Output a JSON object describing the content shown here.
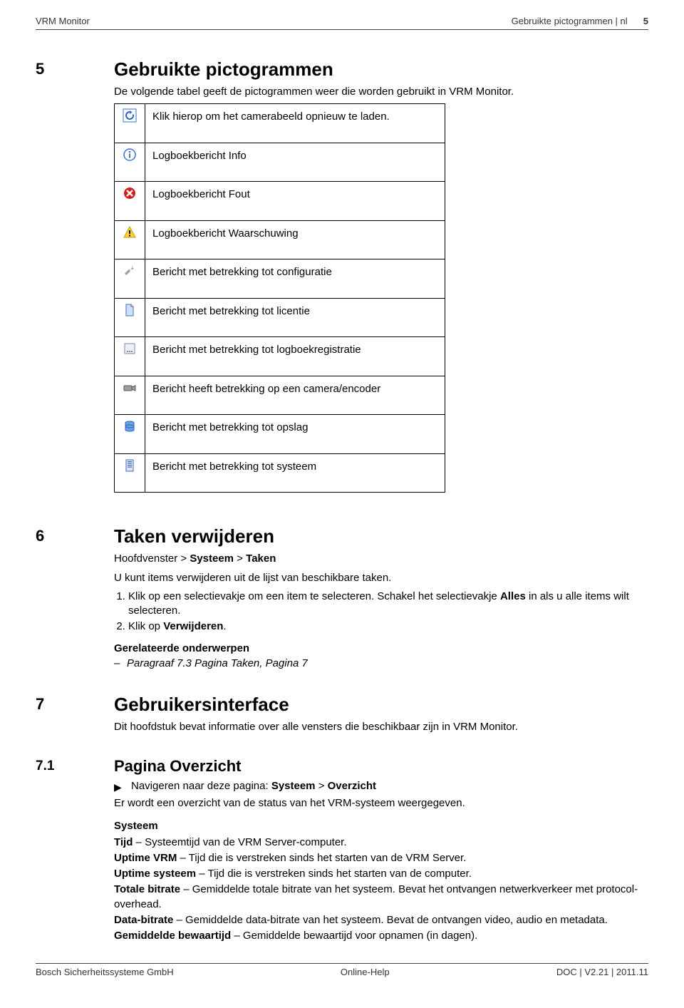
{
  "header": {
    "left": "VRM Monitor",
    "right_title": "Gebruikte pictogrammen | nl",
    "page_num": "5"
  },
  "sec5": {
    "num": "5",
    "title": "Gebruikte pictogrammen",
    "intro": "De volgende tabel geeft de pictogrammen weer die worden gebruikt in VRM Monitor.",
    "rows": [
      "Klik hierop om het camerabeeld opnieuw te laden.",
      "Logboekbericht Info",
      "Logboekbericht Fout",
      "Logboekbericht Waarschuwing",
      "Bericht met betrekking tot configuratie",
      "Bericht met betrekking tot licentie",
      "Bericht met betrekking tot logboekregistratie",
      "Bericht heeft betrekking op een camera/encoder",
      "Bericht met betrekking tot opslag",
      "Bericht met betrekking tot systeem"
    ]
  },
  "sec6": {
    "num": "6",
    "title": "Taken verwijderen",
    "breadcrumb_pre": "Hoofdvenster > ",
    "breadcrumb_b1": "Systeem",
    "breadcrumb_mid": " > ",
    "breadcrumb_b2": "Taken",
    "line1": "U kunt items verwijderen uit de lijst van beschikbare taken.",
    "step1_a": "Klik op een selectievakje om een item te selecteren. Schakel het selectievakje ",
    "step1_b": "Alles",
    "step1_c": " in als u alle items wilt selecteren.",
    "step2_a": "Klik op ",
    "step2_b": "Verwijderen",
    "step2_c": ".",
    "related_head": "Gerelateerde onderwerpen",
    "related_item": "Paragraaf 7.3 Pagina Taken, Pagina 7"
  },
  "sec7": {
    "num": "7",
    "title": "Gebruikersinterface",
    "intro": "Dit hoofdstuk bevat informatie over alle vensters die beschikbaar zijn in VRM Monitor."
  },
  "sec71": {
    "num": "7.1",
    "title": "Pagina Overzicht",
    "nav_pre": "Navigeren naar deze pagina: ",
    "nav_b1": "Systeem",
    "nav_mid": " > ",
    "nav_b2": "Overzicht",
    "line1": "Er wordt een overzicht van de status van het VRM-systeem weergegeven.",
    "sys_head": "Systeem",
    "d1_b": "Tijd",
    "d1_t": " – Systeemtijd van de VRM Server-computer.",
    "d2_b": "Uptime VRM",
    "d2_t": " – Tijd die is verstreken sinds het starten van de VRM Server.",
    "d3_b": "Uptime systeem",
    "d3_t": " – Tijd die is verstreken sinds het starten van de computer.",
    "d4_b": "Totale bitrate",
    "d4_t": " – Gemiddelde totale bitrate van het systeem. Bevat het ontvangen netwerkverkeer met protocol-overhead.",
    "d5_b": "Data-bitrate",
    "d5_t": " – Gemiddelde data-bitrate van het systeem. Bevat de ontvangen video, audio en metadata.",
    "d6_b": "Gemiddelde bewaartijd",
    "d6_t": " – Gemiddelde bewaartijd voor opnamen (in dagen)."
  },
  "footer": {
    "left": "Bosch Sicherheitssysteme GmbH",
    "center": "Online-Help",
    "right": "DOC | V2.21 | 2011.11"
  }
}
